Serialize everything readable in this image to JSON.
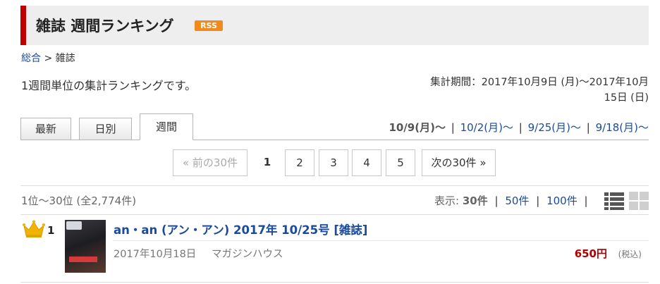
{
  "header": {
    "title": "雑誌 週間ランキング",
    "rss_label": "RSS"
  },
  "breadcrumb": {
    "home": "総合",
    "separator": ">",
    "current": "雑誌"
  },
  "description": "1週間単位の集計ランキングです。",
  "period": {
    "line1": "集計期間：2017年10月9日 (月)〜2017年10月",
    "line2": "15日 (日)"
  },
  "tabs": [
    {
      "label": "最新",
      "active": false
    },
    {
      "label": "日別",
      "active": false
    },
    {
      "label": "週間",
      "active": true
    }
  ],
  "week_nav": {
    "current": "10/9(月)〜",
    "links": [
      "10/2(月)〜",
      "9/25(月)〜",
      "9/18(月)〜"
    ],
    "separator": "|"
  },
  "pager": {
    "prev": "« 前の30件",
    "current": "1",
    "pages": [
      "2",
      "3",
      "4",
      "5"
    ],
    "next": "次の30件 »"
  },
  "result_count": "1位〜30位 (全2,774件)",
  "display": {
    "label": "表示:",
    "current": "30件",
    "options": [
      "50件",
      "100件"
    ],
    "separator": "|"
  },
  "items": [
    {
      "rank": "1",
      "title": "an・an (アン・アン) 2017年 10/25号 [雑誌]",
      "date": "2017年10月18日",
      "publisher": "マガジンハウス",
      "price": "650円",
      "tax_note": "(税込)"
    }
  ],
  "colors": {
    "accent": "#c00000",
    "link": "#1a4a9c",
    "rss": "#f08a1c",
    "price": "#b00000",
    "crown": "#f0b400"
  }
}
